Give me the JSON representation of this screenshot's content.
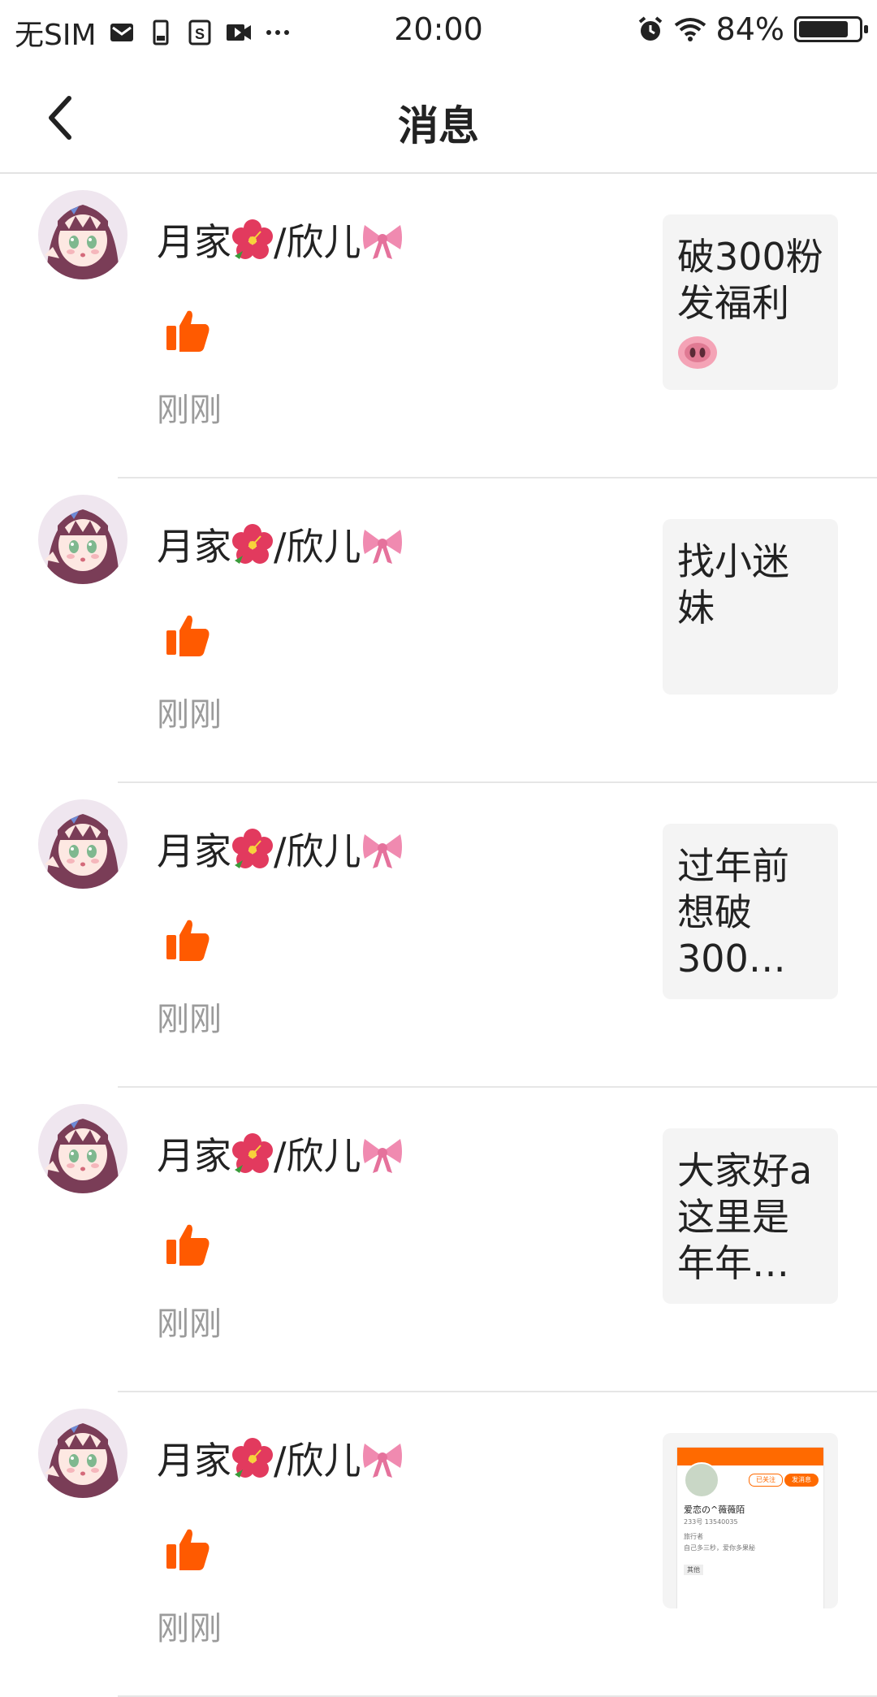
{
  "status_bar": {
    "carrier": "无SIM",
    "time": "20:00",
    "battery": "84%",
    "battery_level": 0.84
  },
  "nav": {
    "title": "消息"
  },
  "messages": [
    {
      "username_a": "月家",
      "username_b": "/欣儿",
      "time": "刚刚",
      "post_text": "破300粉发福利"
    },
    {
      "username_a": "月家",
      "username_b": "/欣儿",
      "time": "刚刚",
      "post_text": "找小迷妹"
    },
    {
      "username_a": "月家",
      "username_b": "/欣儿",
      "time": "刚刚",
      "post_text": "过年前想破300…"
    },
    {
      "username_a": "月家",
      "username_b": "/欣儿",
      "time": "刚刚",
      "post_text": "大家好a这里是年年…"
    },
    {
      "username_a": "月家",
      "username_b": "/欣儿",
      "time": "刚刚"
    }
  ],
  "shot_thumb": {
    "follow": "已关注",
    "message": "发消息",
    "name": "爱恋の^薇薇陌",
    "line1": "233号  13540035",
    "line2": "旅行者",
    "line3": "自己多三秒，爱你多果秘",
    "tag": "其他"
  },
  "colors": {
    "accent": "#ff5a00",
    "muted_text": "#9b9b9b",
    "card_bg": "#f4f4f4"
  }
}
